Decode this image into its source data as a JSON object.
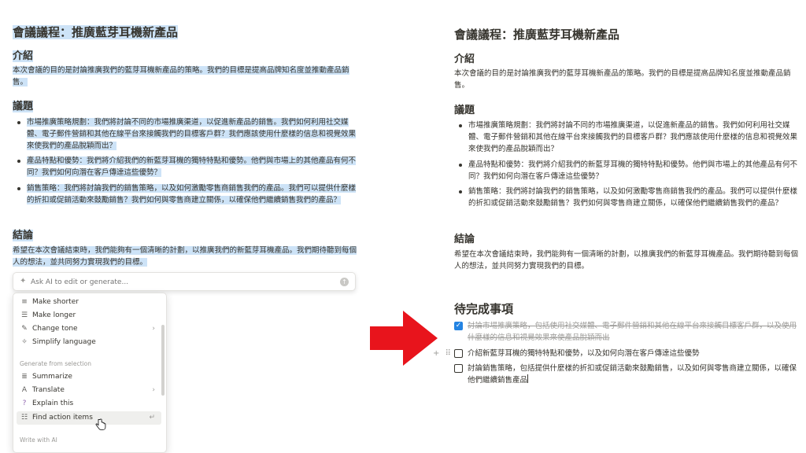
{
  "doc": {
    "title": "會議議程：推廣藍芽耳機新產品",
    "intro_heading": "介紹",
    "intro_text": "本次會議的目的是討論推廣我們的藍芽耳機新產品的策略。我們的目標是提高品牌知名度並推動產品銷售。",
    "topics_heading": "議題",
    "bullets": [
      "市場推廣策略規劃：我們將討論不同的市場推廣渠道，以促進新產品的銷售。我們如何利用社交媒體、電子郵件營銷和其他在線平台來接觸我們的目標客戶群？我們應該使用什麼樣的信息和視覺效果來使我們的產品脫穎而出？",
      "產品特點和優勢：我們將介紹我們的新藍芽耳機的獨特特點和優勢。他們與市場上的其他產品有何不同？我們如何向潛在客戶傳達這些優勢？",
      "銷售策略：我們將討論我們的銷售策略，以及如何激勵零售商銷售我們的產品。我們可以提供什麼樣的折扣或促銷活動來鼓勵銷售？我們如何與零售商建立關係，以確保他們繼續銷售我們的產品？"
    ],
    "conclusion_heading": "結論",
    "conclusion_text": "希望在本次會議結束時，我們能夠有一個清晰的計劃，以推廣我們的新藍芽耳機產品。我們期待聽到每個人的想法，並共同努力實現我們的目標。",
    "todo_heading": "待完成事項",
    "todos": [
      {
        "text": "討論市場推廣策略，包括使用社交媒體、電子郵件營銷和其他在線平台來接觸目標客戶群，以及使用什麼樣的信息和視覺效果來使產品脫穎而出",
        "checked": true
      },
      {
        "text": "介紹新藍芽耳機的獨特特點和優勢，以及如何向潛在客戶傳達這些優勢",
        "checked": false
      },
      {
        "text": "討論銷售策略，包括提供什麼樣的折扣或促銷活動來鼓勵銷售，以及如何與零售商建立關係，以確保他們繼續銷售產品",
        "checked": false
      }
    ]
  },
  "ai": {
    "placeholder": "Ask AI to edit or generate...",
    "items_edit": [
      {
        "label": "Make shorter",
        "icon": "short-lines-icon"
      },
      {
        "label": "Make longer",
        "icon": "long-lines-icon"
      },
      {
        "label": "Change tone",
        "icon": "microphone-icon"
      },
      {
        "label": "Simplify language",
        "icon": "sparkle-icon"
      }
    ],
    "section_generate": "Generate from selection",
    "items_generate": [
      {
        "label": "Summarize",
        "icon": "summary-icon"
      },
      {
        "label": "Translate",
        "icon": "translate-icon"
      },
      {
        "label": "Explain this",
        "icon": "question-icon"
      },
      {
        "label": "Find action items",
        "icon": "checklist-icon"
      }
    ],
    "section_write": "Write with AI"
  },
  "colors": {
    "selection": "#cde3f7",
    "accent": "#2383e2",
    "arrow": "#e8141c"
  }
}
